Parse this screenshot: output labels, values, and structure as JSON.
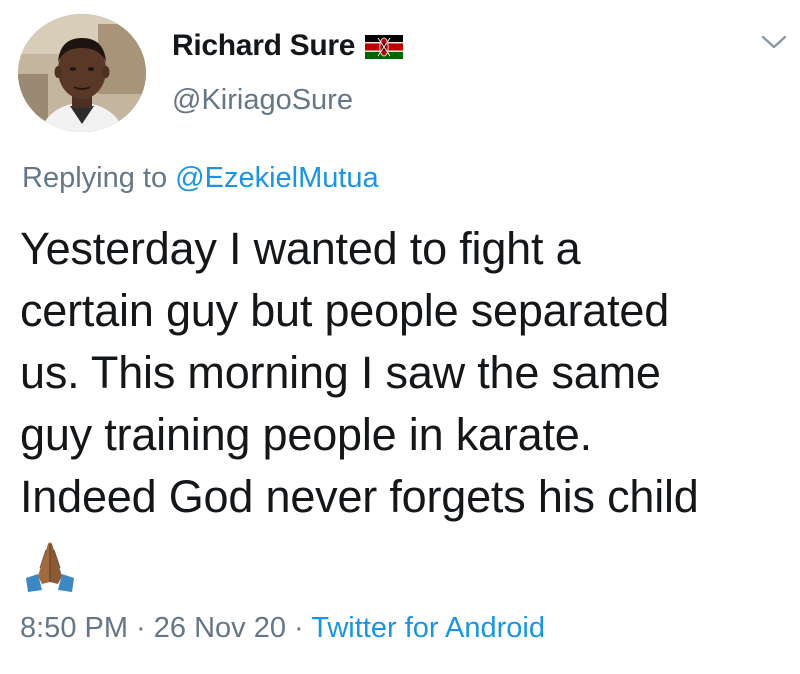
{
  "author": {
    "display_name": "Richard  Sure",
    "handle": "@KiriagoSure",
    "flag_icon": "kenya-flag-icon"
  },
  "reply": {
    "prefix": "Replying to ",
    "mention": "@EzekielMutua"
  },
  "tweet": {
    "lines": [
      "Yesterday I wanted to fight a",
      "certain guy but people separated",
      "us.  This morning I saw the same",
      "guy training people in karate.",
      "Indeed God never forgets his child"
    ],
    "emoji": "folded-hands-emoji"
  },
  "meta": {
    "time": "8:50 PM",
    "sep1": " · ",
    "date": "26 Nov 20",
    "sep2": " · ",
    "source": "Twitter for Android"
  },
  "colors": {
    "text": "#14171a",
    "secondary": "#657786",
    "link": "#1b95e0",
    "background": "#ffffff"
  },
  "icons": [
    "chevron-down-icon"
  ]
}
